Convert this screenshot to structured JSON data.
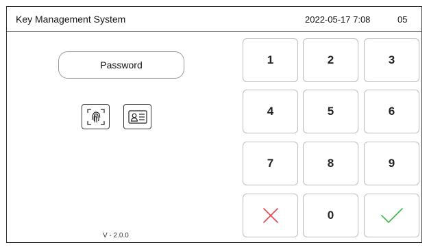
{
  "header": {
    "title": "Key Management System",
    "datetime": "2022-05-17 7:08",
    "unit": "05"
  },
  "login": {
    "password_label": "Password",
    "fingerprint_icon": "fingerprint-icon",
    "id_card_icon": "id-card-icon"
  },
  "keypad": {
    "k1": "1",
    "k2": "2",
    "k3": "3",
    "k4": "4",
    "k5": "5",
    "k6": "6",
    "k7": "7",
    "k8": "8",
    "k9": "9",
    "k0": "0",
    "cancel_icon": "x-icon",
    "confirm_icon": "check-icon"
  },
  "version": "V - 2.0.0",
  "colors": {
    "cancel": "#e8464b",
    "confirm": "#3dbb4a",
    "border": "#333333"
  }
}
